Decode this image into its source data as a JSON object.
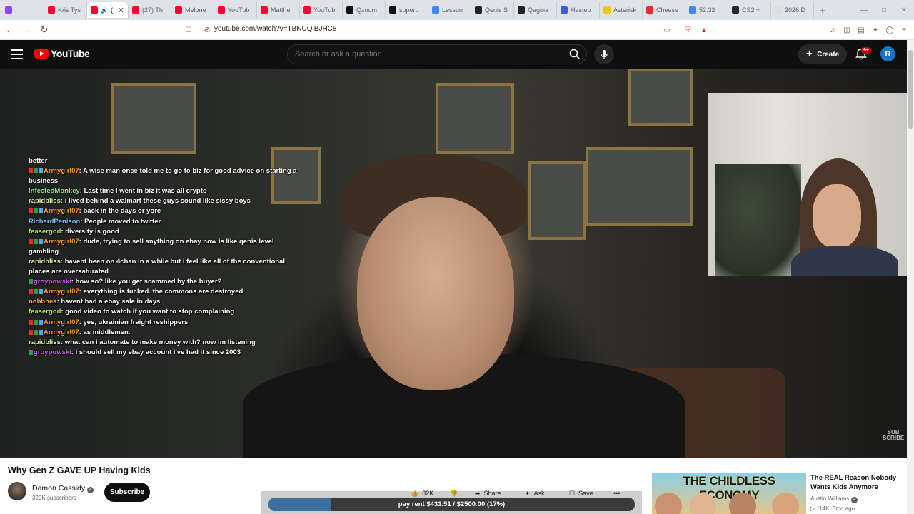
{
  "browser": {
    "tabs": [
      {
        "label": "",
        "color": "#9146ff"
      },
      {
        "label": "Kris Tys",
        "color": "#ff0033"
      },
      {
        "label": "(",
        "color": "#ff0033",
        "active": true
      },
      {
        "label": "(27) Th",
        "color": "#ff0033"
      },
      {
        "label": "Melone",
        "color": "#ff0033"
      },
      {
        "label": "YouTub",
        "color": "#ff0033"
      },
      {
        "label": "Matthe",
        "color": "#ff0033"
      },
      {
        "label": "YouTub",
        "color": "#ff0033"
      },
      {
        "label": "Qzoom",
        "color": "#111111"
      },
      {
        "label": "superb",
        "color": "#111111"
      },
      {
        "label": "Lesson",
        "color": "#4285f4"
      },
      {
        "label": "Qenis S",
        "color": "#222222"
      },
      {
        "label": "Qagina",
        "color": "#222222"
      },
      {
        "label": "Hasteb",
        "color": "#3b5bdb"
      },
      {
        "label": "Asterisk",
        "color": "#f5c518"
      },
      {
        "label": "Cheese",
        "color": "#e03131"
      },
      {
        "label": "52:32",
        "color": "#4285f4"
      },
      {
        "label": "CS2 +",
        "color": "#1b2838"
      },
      {
        "label": "2026 D",
        "color": "#dddddd"
      }
    ],
    "new_tab": "+",
    "url": "youtube.com/watch?v=TBNUQiBJHC8"
  },
  "youtube": {
    "logo_text": "YouTube",
    "search_placeholder": "Search or ask a question",
    "create_label": "Create",
    "notif_badge": "9+",
    "avatar_letter": "R"
  },
  "chat": [
    {
      "user": "",
      "color": "#ffffff",
      "badges": [],
      "text": "better"
    },
    {
      "user": "Armygirl07",
      "color": "#ff9f1c",
      "badges": [
        "#e03131",
        "#2f9e44",
        "#4dabf7"
      ],
      "text": "A wise man once told me to go to biz for good advice on starting a business"
    },
    {
      "user": "InfectedMonkey",
      "color": "#8ce99a",
      "badges": [],
      "text": "Last time I went in biz it was all crypto"
    },
    {
      "user": "rapidbliss",
      "color": "#d8f5a2",
      "badges": [],
      "text": "i lived behind a walmart these guys sound like sissy boys"
    },
    {
      "user": "Armygirl07",
      "color": "#ff9f1c",
      "badges": [
        "#e03131",
        "#2f9e44",
        "#4dabf7"
      ],
      "text": "back in the days or yore"
    },
    {
      "user": "RichardPenison",
      "color": "#74c0fc",
      "badges": [],
      "text": "People moved to twitter"
    },
    {
      "user": "feasergod",
      "color": "#a9e34b",
      "badges": [],
      "text": "diversity is good"
    },
    {
      "user": "Armygirl07",
      "color": "#ff9f1c",
      "badges": [
        "#e03131",
        "#2f9e44",
        "#4dabf7"
      ],
      "text": "dude, trying to sell anything on ebay now is like qenis level gambling"
    },
    {
      "user": "rapidbliss",
      "color": "#d8f5a2",
      "badges": [],
      "text": "havent been on 4chan in a while but i feel like all of the conventional places are oversaturated"
    },
    {
      "user": "groypowski",
      "color": "#cc5de8",
      "badges": [
        "#2f9e44"
      ],
      "text": "how so? like you get scammed by the buyer?"
    },
    {
      "user": "Armygirl07",
      "color": "#ff9f1c",
      "badges": [
        "#e03131",
        "#2f9e44",
        "#4dabf7"
      ],
      "text": "everything is fucked. the commons are destroyed"
    },
    {
      "user": "nobbhea",
      "color": "#ffa94d",
      "badges": [],
      "text": "havent had a ebay sale in days"
    },
    {
      "user": "feasergod",
      "color": "#a9e34b",
      "badges": [],
      "text": "good video to watch if you want to stop complaining"
    },
    {
      "user": "Armygirl07",
      "color": "#ff9f1c",
      "badges": [
        "#e03131",
        "#2f9e44",
        "#4dabf7"
      ],
      "text": "yes, ukrainian freight reshippers"
    },
    {
      "user": "Armygirl07",
      "color": "#ff9f1c",
      "badges": [
        "#e03131",
        "#2f9e44",
        "#4dabf7"
      ],
      "text": "as middlemen."
    },
    {
      "user": "rapidbliss",
      "color": "#d8f5a2",
      "badges": [],
      "text": "what can i automate to make money with? now im listening"
    },
    {
      "user": "groypowski",
      "color": "#cc5de8",
      "badges": [
        "#2f9e44"
      ],
      "text": "i should sell my ebay account i've had it since 2003"
    }
  ],
  "video": {
    "watermark_line1": "SUB",
    "watermark_line2": "SCRIBE",
    "title": "Why Gen Z GAVE UP Having Kids",
    "channel": "Damon Cassidy",
    "subscribers": "320K subscribers",
    "subscribe_label": "Subscribe",
    "likes": "82K",
    "share_label": "Share",
    "ask_label": "Ask",
    "save_label": "Save",
    "more_label": "•••"
  },
  "overlay": {
    "progress_text": "pay rent $431.51 / $2500.00 (17%)",
    "progress_fraction": 0.17
  },
  "recommendation": {
    "thumb_text": "THE CHILDLESS ECONOMY",
    "title": "The REAL Reason Nobody Wants Kids Anymore",
    "channel": "Austin Williams",
    "views": "114K",
    "age": "3mo ago"
  }
}
